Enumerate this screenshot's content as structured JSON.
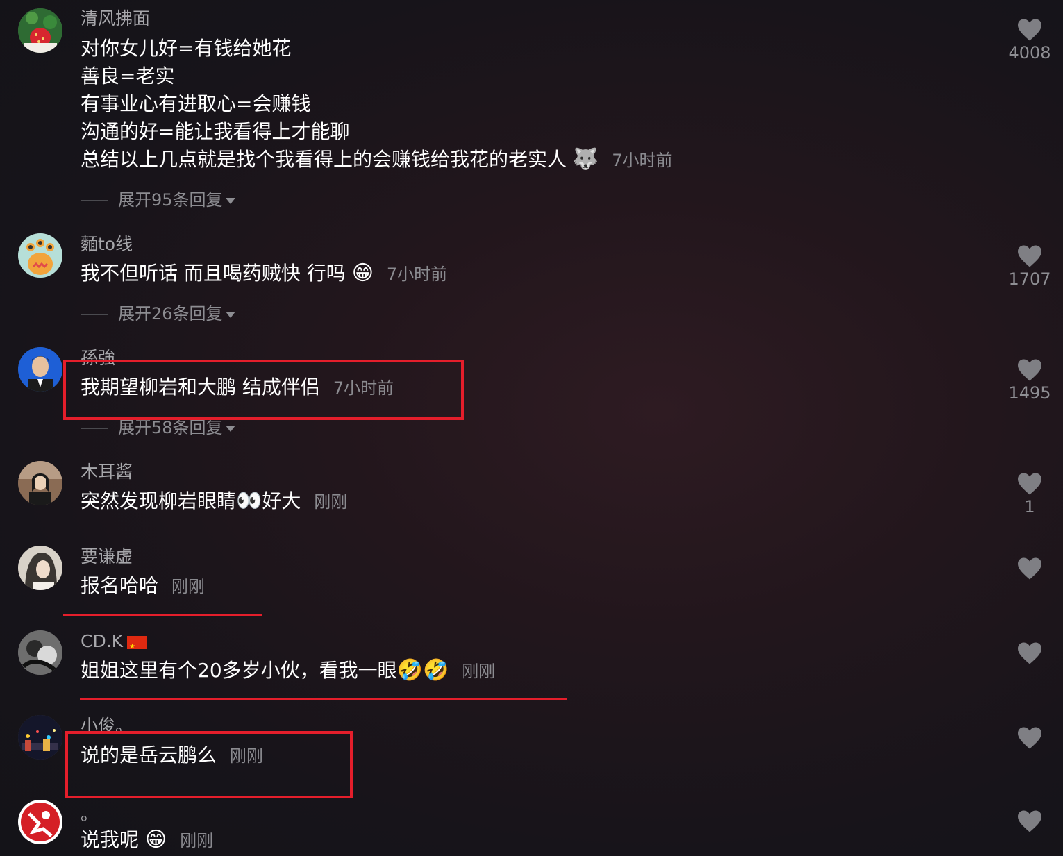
{
  "comments": [
    {
      "username": "清风拂面",
      "lines": [
        "对你女儿好=有钱给她花",
        "善良=老实",
        "有事业心有进取心=会赚钱",
        "沟通的好=能让我看得上才能聊",
        "总结以上几点就是找个我看得上的会赚钱给我花的老实人"
      ],
      "emoji": "🐺",
      "time": "7小时前",
      "replies": "展开95条回复",
      "likes": "4008"
    },
    {
      "username": "麵to线",
      "text": "我不但听话 而且喝药贼快 行吗",
      "emoji": "😁",
      "time": "7小时前",
      "replies": "展开26条回复",
      "likes": "1707"
    },
    {
      "username": "孫強",
      "text": "我期望柳岩和大鹏 结成伴侣",
      "time": "7小时前",
      "replies": "展开58条回复",
      "likes": "1495"
    },
    {
      "username": "木耳酱",
      "text_before": "突然发现柳岩眼睛",
      "emoji": "👀",
      "text_after": "好大",
      "time": "刚刚",
      "likes": "1"
    },
    {
      "username": "要谦虚",
      "text": "报名哈哈",
      "time": "刚刚",
      "likes": ""
    },
    {
      "username": "CD.K",
      "text": "姐姐这里有个20多岁小伙，看我一眼",
      "emoji": "🤣🤣",
      "time": "刚刚",
      "likes": ""
    },
    {
      "username": "小俊。",
      "text": "说的是岳云鹏么",
      "time": "刚刚",
      "likes": ""
    },
    {
      "username": "。",
      "text": "说我呢",
      "emoji": "😁",
      "time": "刚刚",
      "likes": ""
    }
  ],
  "colors": {
    "highlight": "#e41e2b",
    "text": "#ffffff",
    "meta": "#8b8b90"
  },
  "icons": {
    "like": "heart-icon",
    "replies": "triangle-down-icon",
    "flag": "china-flag-icon"
  }
}
